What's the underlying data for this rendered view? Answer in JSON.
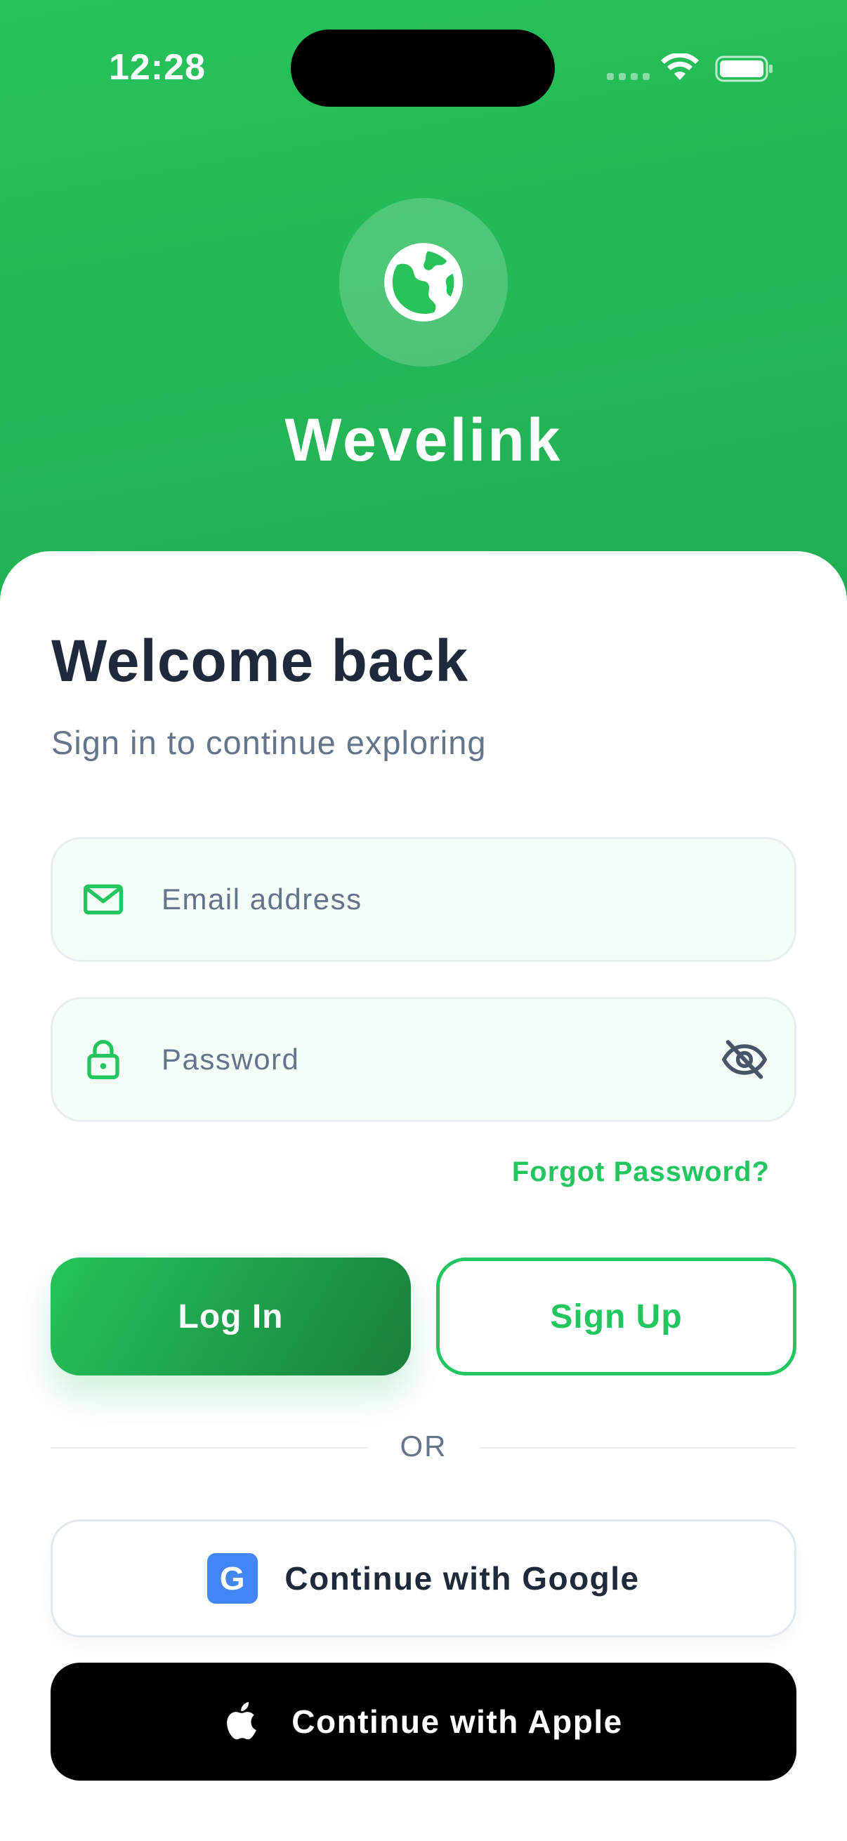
{
  "status_bar": {
    "time": "12:28"
  },
  "brand": {
    "name": "Wevelink",
    "logo_icon": "globe-icon"
  },
  "header": {
    "title": "Welcome back",
    "subtitle": "Sign in to continue exploring"
  },
  "form": {
    "email": {
      "placeholder": "Email address",
      "value": "",
      "icon": "mail-icon"
    },
    "password": {
      "placeholder": "Password",
      "value": "",
      "icon": "lock-icon",
      "toggle_icon": "eye-off-icon"
    },
    "forgot_label": "Forgot Password?"
  },
  "actions": {
    "login_label": "Log In",
    "signup_label": "Sign Up"
  },
  "divider": {
    "label": "OR"
  },
  "social": {
    "google_label": "Continue with Google",
    "google_icon_letter": "G",
    "apple_label": "Continue with Apple"
  },
  "colors": {
    "brand_green": "#22c55e",
    "text_dark": "#1e293b",
    "text_muted": "#64748b",
    "google_blue": "#4285f4"
  }
}
